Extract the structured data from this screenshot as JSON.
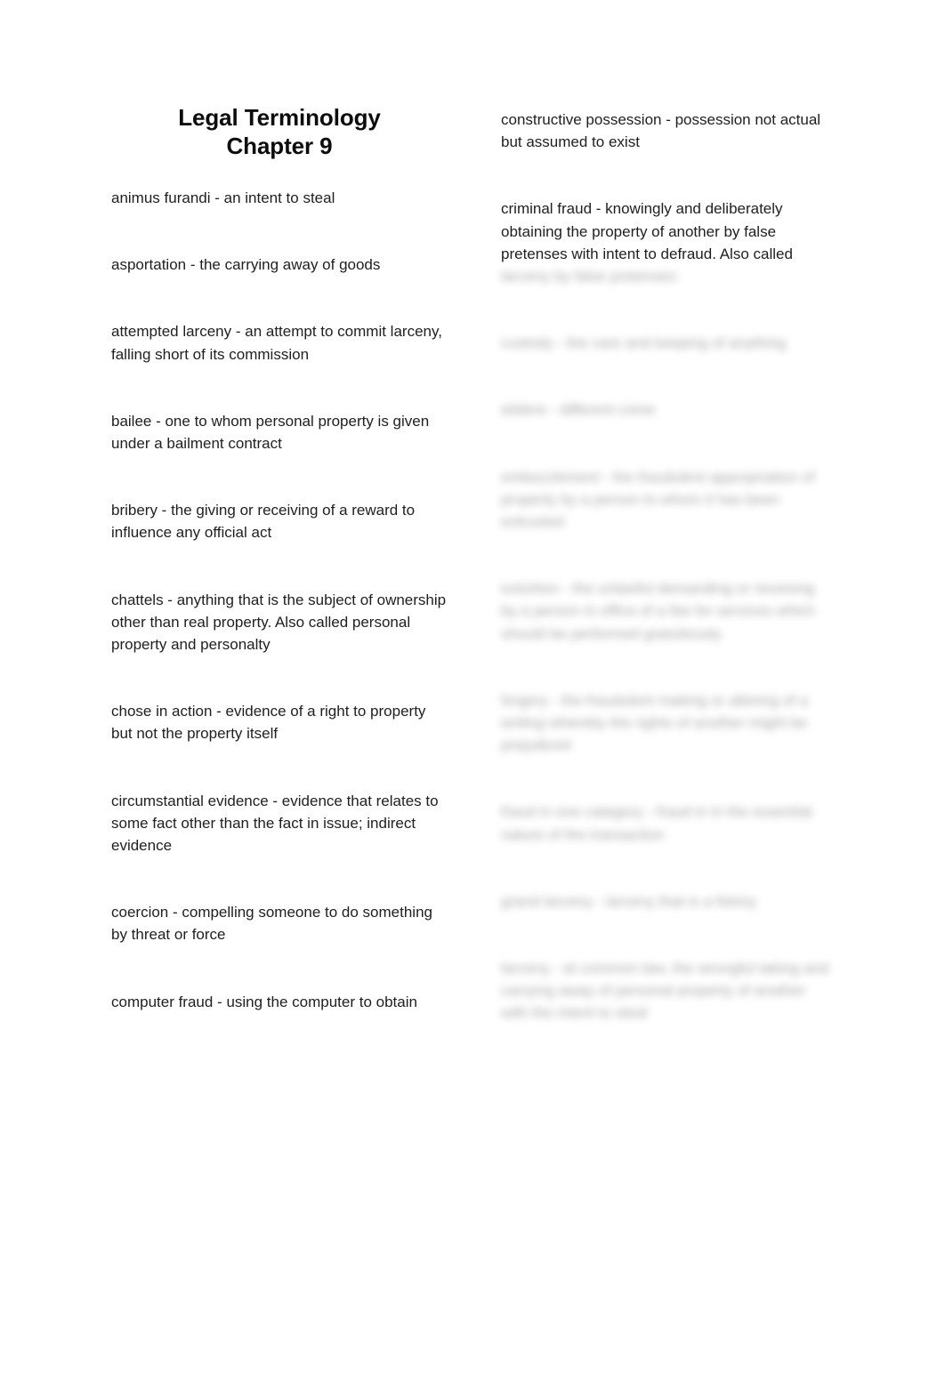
{
  "document": {
    "title_lines": [
      "Legal Terminology",
      "Chapter 9"
    ]
  },
  "left_column": {
    "entries": [
      "animus furandi - an intent to steal",
      "asportation - the carrying away of goods",
      "attempted larceny - an attempt to commit larceny, falling short of its commission",
      "bailee - one to whom personal property is given under a bailment contract",
      "bribery - the giving or receiving of a reward to influence any official act",
      "chattels - anything that is the subject of ownership other than real property. Also called personal property and personalty",
      "chose in action - evidence of a right to property but not the property itself",
      "circumstantial evidence - evidence that relates to some fact other than the fact in issue; indirect evidence",
      "coercion - compelling someone to do something by threat or force",
      "computer fraud - using the computer to obtain"
    ]
  },
  "right_column": {
    "entries": [
      {
        "text": "constructive possession - possession not actual but assumed to exist",
        "redacted": false,
        "redacted_tail": ""
      },
      {
        "text": "criminal fraud - knowingly and deliberately obtaining the property of another by false pretenses with intent to defraud. Also called",
        "redacted": false,
        "redacted_tail": "larceny by false pretenses"
      },
      {
        "text": "custody - the care and keeping of anything",
        "redacted": true,
        "redacted_tail": ""
      },
      {
        "text": "elidere - different crime",
        "redacted": true,
        "redacted_tail": ""
      },
      {
        "text": "embezzlement - the fraudulent appropriation of property by a person to whom it has been entrusted",
        "redacted": true,
        "redacted_tail": ""
      },
      {
        "text": "extortion - the unlawful demanding or receiving by a person in office of a fee for services which should be performed gratuitously",
        "redacted": true,
        "redacted_tail": ""
      },
      {
        "text": "forgery - the fraudulent making or altering of a writing whereby the rights of another might be prejudiced",
        "redacted": true,
        "redacted_tail": ""
      },
      {
        "text": "fraud in one category - fraud in in the essential nature of the transaction",
        "redacted": true,
        "redacted_tail": ""
      },
      {
        "text": "grand larceny - larceny that is a felony",
        "redacted": true,
        "redacted_tail": ""
      },
      {
        "text": "larceny - at common law, the wrongful taking and carrying away of personal property of another with the intent to steal",
        "redacted": true,
        "redacted_tail": ""
      }
    ]
  }
}
